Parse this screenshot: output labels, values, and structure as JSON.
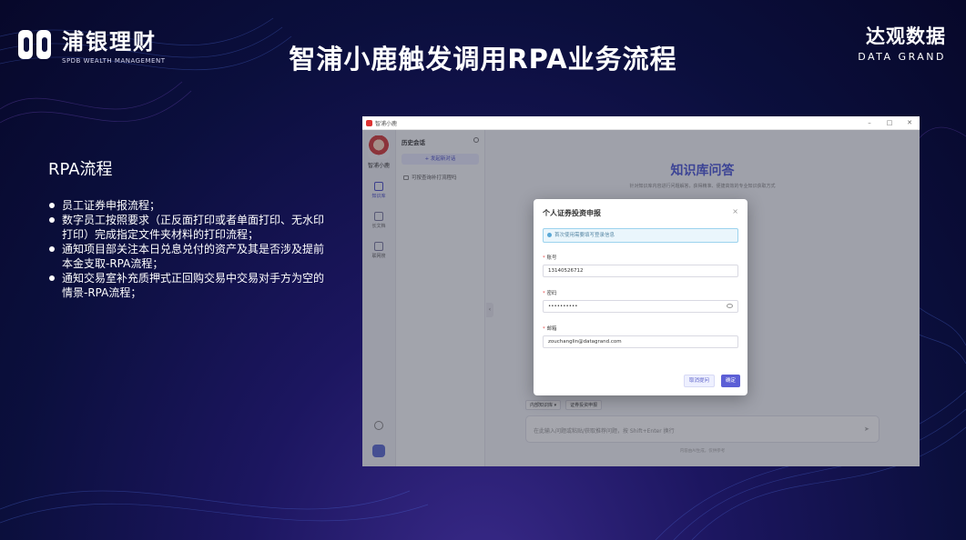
{
  "header": {
    "logo_left_main": "浦银理财",
    "logo_left_sub": "SPDB WEALTH MANAGEMENT",
    "title": "智浦小鹿触发调用RPA业务流程",
    "logo_right_cn": "达观数据",
    "logo_right_en": "DATA GRAND"
  },
  "content": {
    "section_heading": "RPA流程",
    "bullets": [
      "员工证券申报流程；",
      "数字员工按照要求（正反面打印或者单面打印、无水印打印）完成指定文件夹材料的打印流程；",
      "通知项目部关注本日兑息兑付的资产及其是否涉及提前本金支取-RPA流程；",
      "通知交易室补充质押式正回购交易中交易对手方为空的情景-RPA流程；"
    ]
  },
  "app": {
    "window_title": "智浦小鹿",
    "rail": {
      "name": "智浦小鹿",
      "items": [
        "知识库",
        "长文档",
        "联网搜"
      ]
    },
    "history": {
      "title": "历史会话",
      "new_chat": "+ 发起新对话",
      "items": [
        "可按查询补打流程吗"
      ]
    },
    "main": {
      "kb_title": "知识库问答",
      "kb_subtitle": "针对知识库内容进行问题解答，获得精准、便捷高效的专业知识获取方式",
      "chips": [
        "内部知识库 ▾",
        "证券投资申报"
      ],
      "chat_placeholder": "在此输入问题或粘贴/获取推荐问题，按 Shift+Enter 换行",
      "disclaimer": "内容由AI生成，仅供参考"
    },
    "modal": {
      "title": "个人证券投资申报",
      "close": "×",
      "notice": "首次使用需要填写登录信息",
      "fields": [
        {
          "label": "账号",
          "value": "13140526712"
        },
        {
          "label": "密码",
          "value": "••••••••••"
        },
        {
          "label": "邮箱",
          "value": "zouchanglin@datagrand.com"
        }
      ],
      "cancel": "取消提问",
      "confirm": "确定"
    }
  }
}
